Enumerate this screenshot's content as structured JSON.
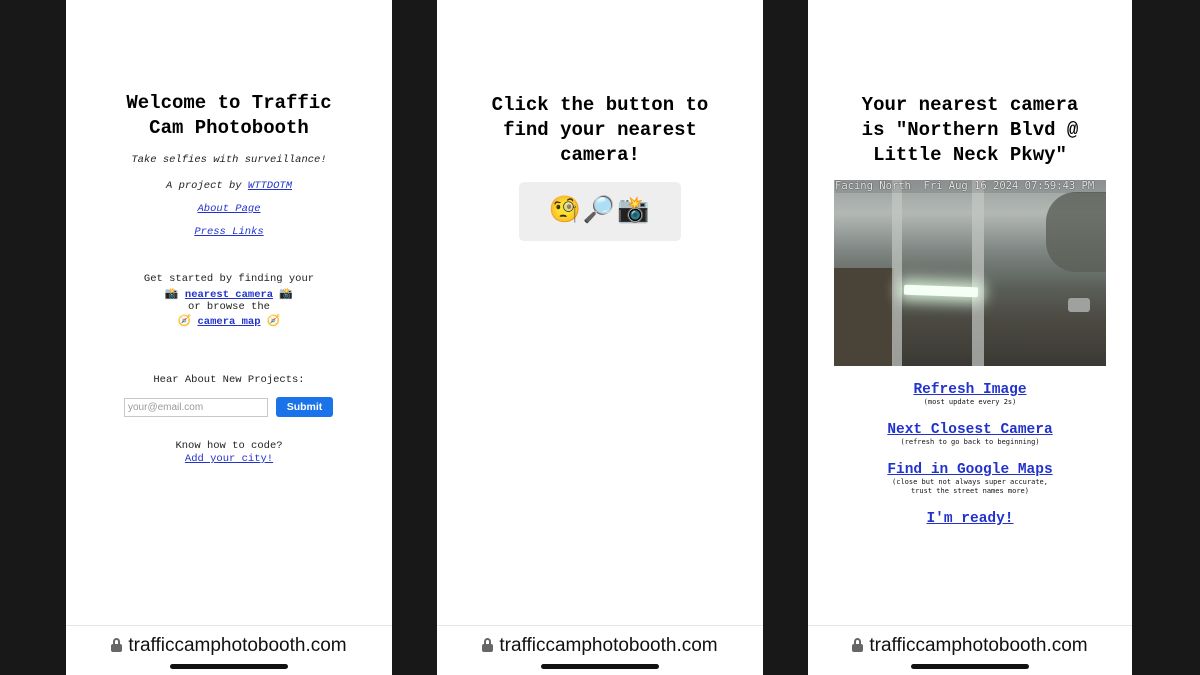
{
  "phone1": {
    "title": "Welcome to Traffic\nCam Photobooth",
    "tagline": "Take selfies with surveillance!",
    "project_prefix": "A project by",
    "project_link": "WTTDOTM",
    "about_link": "About Page",
    "press_link": "Press Links",
    "started_text": "Get started by finding your",
    "nearest_camera_link": "nearest camera",
    "browse_text": "or browse the",
    "camera_map_link": "camera map",
    "newsletter_label": "Hear About New Projects:",
    "email_placeholder": "your@email.com",
    "submit_label": "Submit",
    "code_text": "Know how to code?",
    "add_city_link": "Add your city!",
    "camera_emoji": "📸",
    "compass_emoji": "🧭"
  },
  "phone2": {
    "title": "Click the button to\nfind your nearest\ncamera!",
    "button_icons": "🧐🔎📸"
  },
  "phone3": {
    "title": "Your nearest camera\nis \"Northern Blvd @\nLittle Neck Pkwy\"",
    "camera_overlay": "Facing North  Fri Aug 16 2024 07:59:43 PM",
    "refresh_link": "Refresh Image",
    "refresh_note": "(most update every 2s)",
    "next_link": "Next Closest Camera",
    "next_note": "(refresh to go back to beginning)",
    "maps_link": "Find in Google Maps",
    "maps_note_1": "(close but not always super accurate,",
    "maps_note_2": "trust the street names more)",
    "ready_link": "I'm ready!"
  },
  "url": "trafficcamphotobooth.com",
  "colors": {
    "link": "#2233cc",
    "submit": "#1a73e8",
    "background": "#181818"
  }
}
